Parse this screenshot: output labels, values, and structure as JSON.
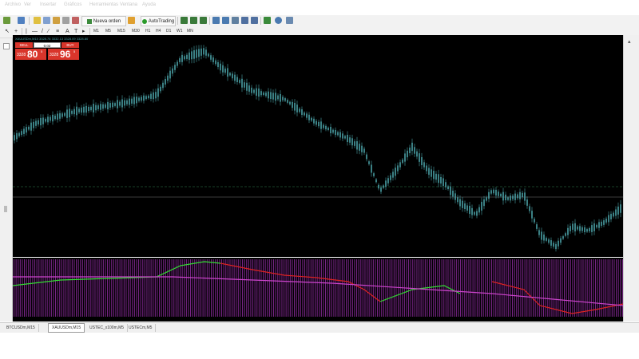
{
  "menu": [
    "Archivo",
    "Ver",
    "Insertar",
    "Gráficos",
    "Herramientas",
    "Ventana",
    "Ayuda"
  ],
  "toolbar": {
    "new_order_label": "Nueva orden",
    "autotrading_label": "AutoTrading",
    "timeframes": [
      "M1",
      "M5",
      "M15",
      "M30",
      "H1",
      "H4",
      "D1",
      "W1",
      "MN"
    ]
  },
  "trade_panel": {
    "sell_label": "SELL",
    "buy_label": "BUY",
    "lot_value": "0.02",
    "sell_price_small": "3328",
    "sell_price_big": "80",
    "sell_price_sup": "5",
    "buy_price_small": "3328",
    "buy_price_big": "96",
    "buy_price_sup": "5"
  },
  "chart_title": "XAUUSDm,M15  3328.76 3332.13 3328.09 3328.80",
  "tabs": [
    "BTCUSDm,M15",
    "XAUUSDm,M15",
    "USTEC_x100m,M5",
    "USTECm,M5"
  ],
  "active_tab": "XAUUSDm,M15",
  "colors": {
    "chart_bg": "#000000",
    "candle": "#4a9fa5",
    "indicator_bars": "#8b2a9b",
    "indicator_green": "#33dd33",
    "indicator_red": "#dd2222",
    "indicator_purple": "#cc44cc",
    "sell_buy": "#d9352b"
  }
}
